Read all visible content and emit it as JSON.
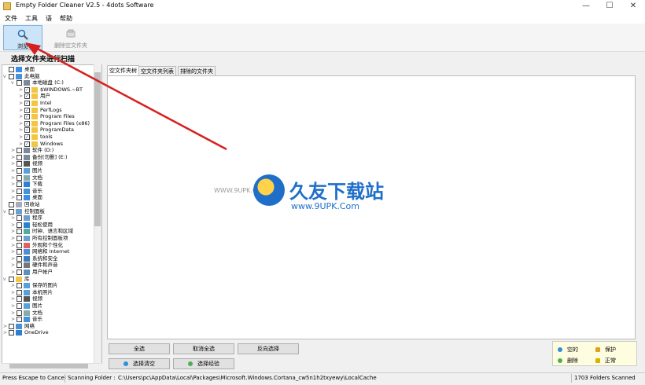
{
  "window": {
    "title": "Empty Folder Cleaner V2.5 - 4dots Software",
    "controls": [
      "—",
      "☐",
      "✕"
    ]
  },
  "menu": [
    "文件",
    "工具",
    "语",
    "帮助"
  ],
  "toolbar": {
    "scan_label": "浏览",
    "delete_label": "删除空文件夹"
  },
  "heading": "选择文件夹进行扫描",
  "tree": [
    {
      "level": 0,
      "chev": "",
      "cb": "",
      "icon": "desktop",
      "label": "桌面"
    },
    {
      "level": 0,
      "chev": "v",
      "cb": "",
      "icon": "pc",
      "label": "此电脑"
    },
    {
      "level": 1,
      "chev": "v",
      "cb": "",
      "icon": "drive",
      "label": "本地磁盘 (C:)"
    },
    {
      "level": 2,
      "chev": ">",
      "cb": "✓",
      "icon": "folder",
      "label": "$WINDOWS.~BT"
    },
    {
      "level": 2,
      "chev": ">",
      "cb": "✓",
      "icon": "folder",
      "label": "用户"
    },
    {
      "level": 2,
      "chev": ">",
      "cb": "✓",
      "icon": "folder",
      "label": "Intel"
    },
    {
      "level": 2,
      "chev": ">",
      "cb": "✓",
      "icon": "folder",
      "label": "PerfLogs"
    },
    {
      "level": 2,
      "chev": ">",
      "cb": "✓",
      "icon": "folder",
      "label": "Program Files"
    },
    {
      "level": 2,
      "chev": ">",
      "cb": "✓",
      "icon": "folder",
      "label": "Program Files (x86)"
    },
    {
      "level": 2,
      "chev": ">",
      "cb": "✓",
      "icon": "folder",
      "label": "ProgramData"
    },
    {
      "level": 2,
      "chev": ">",
      "cb": "✓",
      "icon": "folder",
      "label": "tools"
    },
    {
      "level": 2,
      "chev": ">",
      "cb": "✓",
      "icon": "folder",
      "label": "Windows"
    },
    {
      "level": 1,
      "chev": ">",
      "cb": "",
      "icon": "drive",
      "label": "软件 (D:)"
    },
    {
      "level": 1,
      "chev": ">",
      "cb": "",
      "icon": "drive",
      "label": "备份[勿删] (E:)"
    },
    {
      "level": 1,
      "chev": ">",
      "cb": "",
      "icon": "video",
      "label": "视频"
    },
    {
      "level": 1,
      "chev": ">",
      "cb": "",
      "icon": "picture",
      "label": "图片"
    },
    {
      "level": 1,
      "chev": ">",
      "cb": "",
      "icon": "doc",
      "label": "文档"
    },
    {
      "level": 1,
      "chev": ">",
      "cb": "",
      "icon": "download",
      "label": "下载"
    },
    {
      "level": 1,
      "chev": ">",
      "cb": "",
      "icon": "music",
      "label": "音乐"
    },
    {
      "level": 1,
      "chev": ">",
      "cb": "",
      "icon": "desktop",
      "label": "桌面"
    },
    {
      "level": 0,
      "chev": "",
      "cb": "",
      "icon": "bin",
      "label": "回收站"
    },
    {
      "level": 0,
      "chev": "v",
      "cb": "",
      "icon": "panel",
      "label": "控制面板"
    },
    {
      "level": 1,
      "chev": ">",
      "cb": "",
      "icon": "panel",
      "label": "程序"
    },
    {
      "level": 1,
      "chev": ">",
      "cb": "",
      "icon": "ease",
      "label": "轻松使用"
    },
    {
      "level": 1,
      "chev": ">",
      "cb": "",
      "icon": "clock",
      "label": "时钟、语言和区域"
    },
    {
      "level": 1,
      "chev": ">",
      "cb": "",
      "icon": "panel",
      "label": "所有控制面板项"
    },
    {
      "level": 1,
      "chev": ">",
      "cb": "",
      "icon": "paint",
      "label": "外观和个性化"
    },
    {
      "level": 1,
      "chev": ">",
      "cb": "",
      "icon": "net",
      "label": "网络和 Internet"
    },
    {
      "level": 1,
      "chev": ">",
      "cb": "",
      "icon": "shield",
      "label": "系统和安全"
    },
    {
      "level": 1,
      "chev": ">",
      "cb": "",
      "icon": "printer",
      "label": "硬件和声音"
    },
    {
      "level": 1,
      "chev": ">",
      "cb": "",
      "icon": "user",
      "label": "用户帐户"
    },
    {
      "level": 0,
      "chev": "v",
      "cb": "",
      "icon": "folder",
      "label": "库"
    },
    {
      "level": 1,
      "chev": ">",
      "cb": "",
      "icon": "picture",
      "label": "保存的图片"
    },
    {
      "level": 1,
      "chev": ">",
      "cb": "",
      "icon": "picture",
      "label": "本机照片"
    },
    {
      "level": 1,
      "chev": ">",
      "cb": "",
      "icon": "video",
      "label": "视频"
    },
    {
      "level": 1,
      "chev": ">",
      "cb": "",
      "icon": "picture",
      "label": "图片"
    },
    {
      "level": 1,
      "chev": ">",
      "cb": "",
      "icon": "doc",
      "label": "文档"
    },
    {
      "level": 1,
      "chev": ">",
      "cb": "",
      "icon": "music",
      "label": "音乐"
    },
    {
      "level": 0,
      "chev": ">",
      "cb": "",
      "icon": "net",
      "label": "网络"
    },
    {
      "level": 0,
      "chev": ">",
      "cb": "",
      "icon": "cloud",
      "label": "OneDrive"
    }
  ],
  "tabs": [
    "空文件夹树",
    "空文件夹列表",
    "排除的文件夹"
  ],
  "watermark": {
    "left": "WWW.9UPK.COM",
    "cn": "久友下载站",
    "url": "www.9UPK.Com"
  },
  "buttons": {
    "select_all": "全选",
    "deselect_all": "取消全选",
    "invert": "反向选择",
    "select_empty": "选择清空",
    "select_protected": "选择经验"
  },
  "legend": {
    "empty": "空的",
    "protected": "保护",
    "removed": "删除",
    "normal": "正常"
  },
  "colors": {
    "empty": "#2f8fd8",
    "protected": "#e0a020",
    "removed": "#4caf50",
    "normal": "#d8b400",
    "selected": "#cce4f7"
  },
  "status": {
    "hint": "Press Escape to Cancel",
    "scanning_label": "Scanning Folder :",
    "scanning_path": "C:\\Users\\pc\\AppData\\Local\\Packages\\Microsoft.Windows.Cortana_cw5n1h2txyewy\\LocalCache",
    "count": "1703 Folders Scanned"
  }
}
